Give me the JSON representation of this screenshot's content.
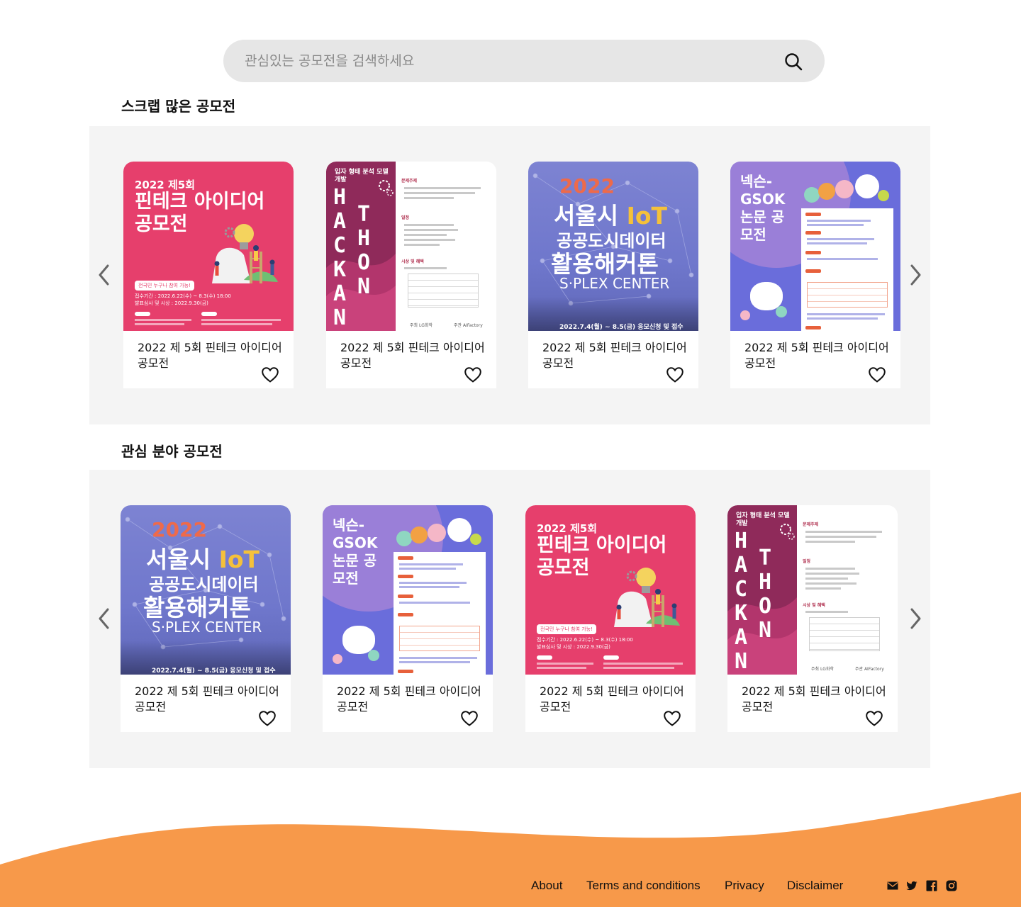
{
  "search": {
    "placeholder": "관심있는 공모전을 검색하세요",
    "icon": "search-icon"
  },
  "sections": [
    {
      "title": "스크랩 많은 공모전",
      "cards": [
        {
          "title": "2022 제 5회 핀테크 아이디어 공모전",
          "poster": "fintech"
        },
        {
          "title": "2022 제 5회 핀테크 아이디어 공모전",
          "poster": "hackathon"
        },
        {
          "title": "2022 제 5회 핀테크 아이디어 공모전",
          "poster": "seoul"
        },
        {
          "title": "2022 제 5회 핀테크 아이디어 공모전",
          "poster": "nexon"
        }
      ]
    },
    {
      "title": "관심 분야 공모전",
      "cards": [
        {
          "title": "2022 제 5회 핀테크 아이디어 공모전",
          "poster": "seoul"
        },
        {
          "title": "2022 제 5회 핀테크 아이디어 공모전",
          "poster": "nexon"
        },
        {
          "title": "2022 제 5회 핀테크 아이디어 공모전",
          "poster": "fintech"
        },
        {
          "title": "2022 제 5회 핀테크 아이디어 공모전",
          "poster": "hackathon"
        }
      ]
    }
  ],
  "posters": {
    "fintech": {
      "edition": "2022 제5회",
      "title_line1": "핀테크 아이디어",
      "title_line2": "공모전",
      "badge": "전국민 누구나 참여 가능!",
      "period": "접수기간 : 2022.6.22(수) ~ 8.3(수) 18:00",
      "announce": "발표심사 및 시상 : 2022.9.30(금)"
    },
    "hackathon": {
      "heading": "입자 형태 분석 모델 개발",
      "letters_left": "HACKAN",
      "letters_right": "THON",
      "sections": [
        "문제주제",
        "일정",
        "시상 및 혜택"
      ],
      "host": "주최 LG화학",
      "organizer": "주관 AIFactory"
    },
    "seoul": {
      "year": "2022",
      "line1_a": "서울시",
      "line1_b": "IoT",
      "line2": "공공도시데이터",
      "line3": "활용해커톤",
      "line4": "S·PLEX CENTER",
      "date": "2022.7.4(월) ~ 8.5(금) 응모신청 및 접수"
    },
    "nexon": {
      "title": "넥슨-GSOK 논문 공모전"
    }
  },
  "footer": {
    "links": [
      "About",
      "Terms and conditions",
      "Privacy",
      "Disclaimer"
    ],
    "social_icons": [
      "mail-icon",
      "twitter-icon",
      "facebook-icon",
      "instagram-icon"
    ],
    "wave_color": "#f7994a"
  },
  "colors": {
    "panel": "#f4f4f4",
    "search_bg": "#e6e6e6",
    "accent_orange": "#f7994a"
  }
}
